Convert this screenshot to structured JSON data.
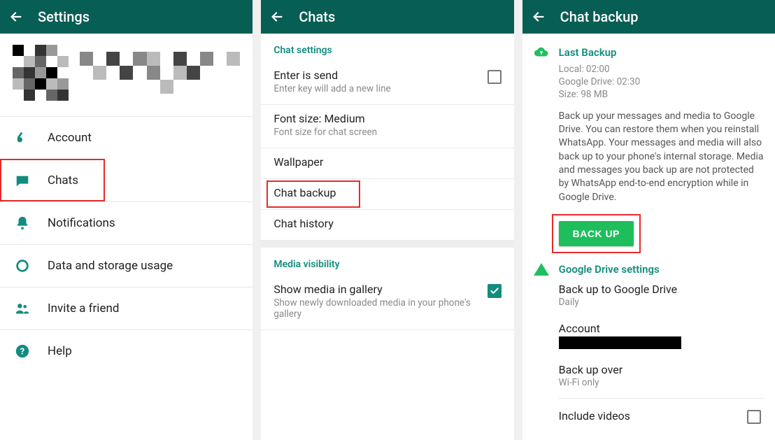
{
  "panel1": {
    "header": {
      "title": "Settings"
    },
    "items": [
      {
        "label": "Account",
        "icon": "key-icon"
      },
      {
        "label": "Chats",
        "icon": "chat-icon",
        "highlight": true
      },
      {
        "label": "Notifications",
        "icon": "bell-icon"
      },
      {
        "label": "Data and storage usage",
        "icon": "data-circle-icon"
      },
      {
        "label": "Invite a friend",
        "icon": "people-icon"
      },
      {
        "label": "Help",
        "icon": "help-icon"
      }
    ]
  },
  "panel2": {
    "header": {
      "title": "Chats"
    },
    "section_chat_settings": "Chat settings",
    "rows": {
      "enter_is_send": {
        "primary": "Enter is send",
        "secondary": "Enter key will add a new line",
        "checked": false
      },
      "font_size": {
        "primary": "Font size: Medium",
        "secondary": "Font size for chat screen"
      },
      "wallpaper": {
        "primary": "Wallpaper"
      },
      "chat_backup": {
        "primary": "Chat backup"
      },
      "chat_history": {
        "primary": "Chat history"
      }
    },
    "section_media": "Media visibility",
    "media_row": {
      "primary": "Show media in gallery",
      "secondary": "Show newly downloaded media in your phone's gallery",
      "checked": true
    }
  },
  "panel3": {
    "header": {
      "title": "Chat backup"
    },
    "last_backup_label": "Last Backup",
    "meta": {
      "local": "Local: 02:00",
      "gdrive": "Google Drive: 02:30",
      "size": "Size: 98 MB"
    },
    "description": "Back up your messages and media to Google Drive. You can restore them when you reinstall WhatsApp. Your messages and media will also back up to your phone's internal storage. Media and messages you back up are not protected by WhatsApp end-to-end encryption while in Google Drive.",
    "backup_button": "BACK UP",
    "gd_settings_label": "Google Drive settings",
    "gd_rows": {
      "backup_to": {
        "primary": "Back up to Google Drive",
        "secondary": "Daily"
      },
      "account": {
        "primary": "Account"
      },
      "back_over": {
        "primary": "Back up over",
        "secondary": "Wi-Fi only"
      },
      "include": {
        "primary": "Include videos",
        "checked": false
      }
    }
  }
}
